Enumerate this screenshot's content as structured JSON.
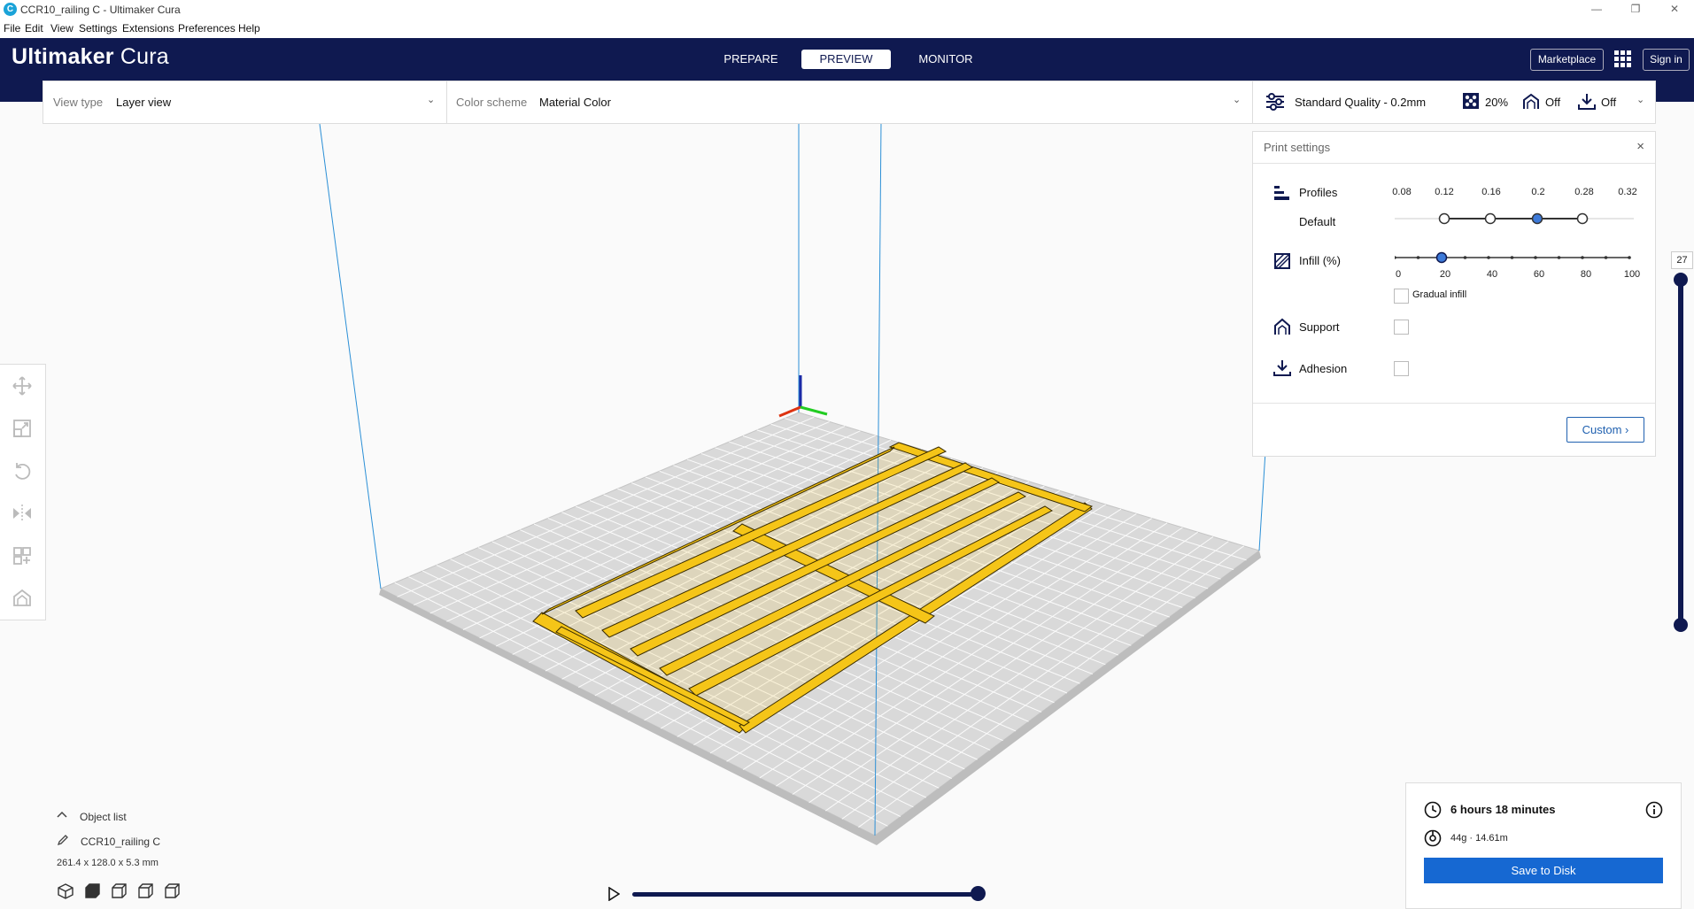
{
  "window": {
    "title": "CCR10_railing C - Ultimaker Cura",
    "icon_letter": "C",
    "controls": {
      "minimize": "—",
      "maximize": "❐",
      "close": "✕"
    }
  },
  "menu": {
    "items": [
      "File",
      "Edit",
      "View",
      "Settings",
      "Extensions",
      "Preferences",
      "Help"
    ]
  },
  "header": {
    "brand_bold": "Ultimaker",
    "brand_light": "Cura",
    "stages": [
      "PREPARE",
      "PREVIEW",
      "MONITOR"
    ],
    "active_stage": "PREVIEW",
    "marketplace": "Marketplace",
    "sign_in": "Sign in"
  },
  "toolbar": {
    "view_type_label": "View type",
    "view_type_value": "Layer view",
    "color_scheme_label": "Color scheme",
    "color_scheme_value": "Material Color",
    "quality": "Standard Quality - 0.2mm",
    "infill": "20%",
    "support": "Off",
    "adhesion": "Off"
  },
  "print_settings": {
    "title": "Print settings",
    "close": "×",
    "profiles_label": "Profiles",
    "profile_default": "Default",
    "profile_ticks": [
      "0.08",
      "0.12",
      "0.16",
      "0.2",
      "0.28",
      "0.32"
    ],
    "profile_selected": "0.2",
    "infill_label": "Infill (%)",
    "infill_ticks": [
      "0",
      "20",
      "40",
      "60",
      "80",
      "100"
    ],
    "infill_value": 20,
    "gradual_infill": "Gradual infill",
    "support_label": "Support",
    "adhesion_label": "Adhesion",
    "custom_button": "Custom",
    "custom_chevron": "›"
  },
  "layer_slider": {
    "value": "27",
    "position": 1.0
  },
  "object_list": {
    "toggle": "Object list",
    "object_name": "CCR10_railing C",
    "dimensions": "261.4 x 128.0 x 5.3 mm"
  },
  "estimate": {
    "time": "6 hours 18 minutes",
    "material": "44g · 14.61m",
    "save_button": "Save to Disk"
  },
  "simulation": {
    "progress": 1.0
  },
  "colors": {
    "header": "#0f1950",
    "accent": "#1668d2",
    "filament": "#f5c518",
    "build_plate": "#d9d9d9"
  }
}
